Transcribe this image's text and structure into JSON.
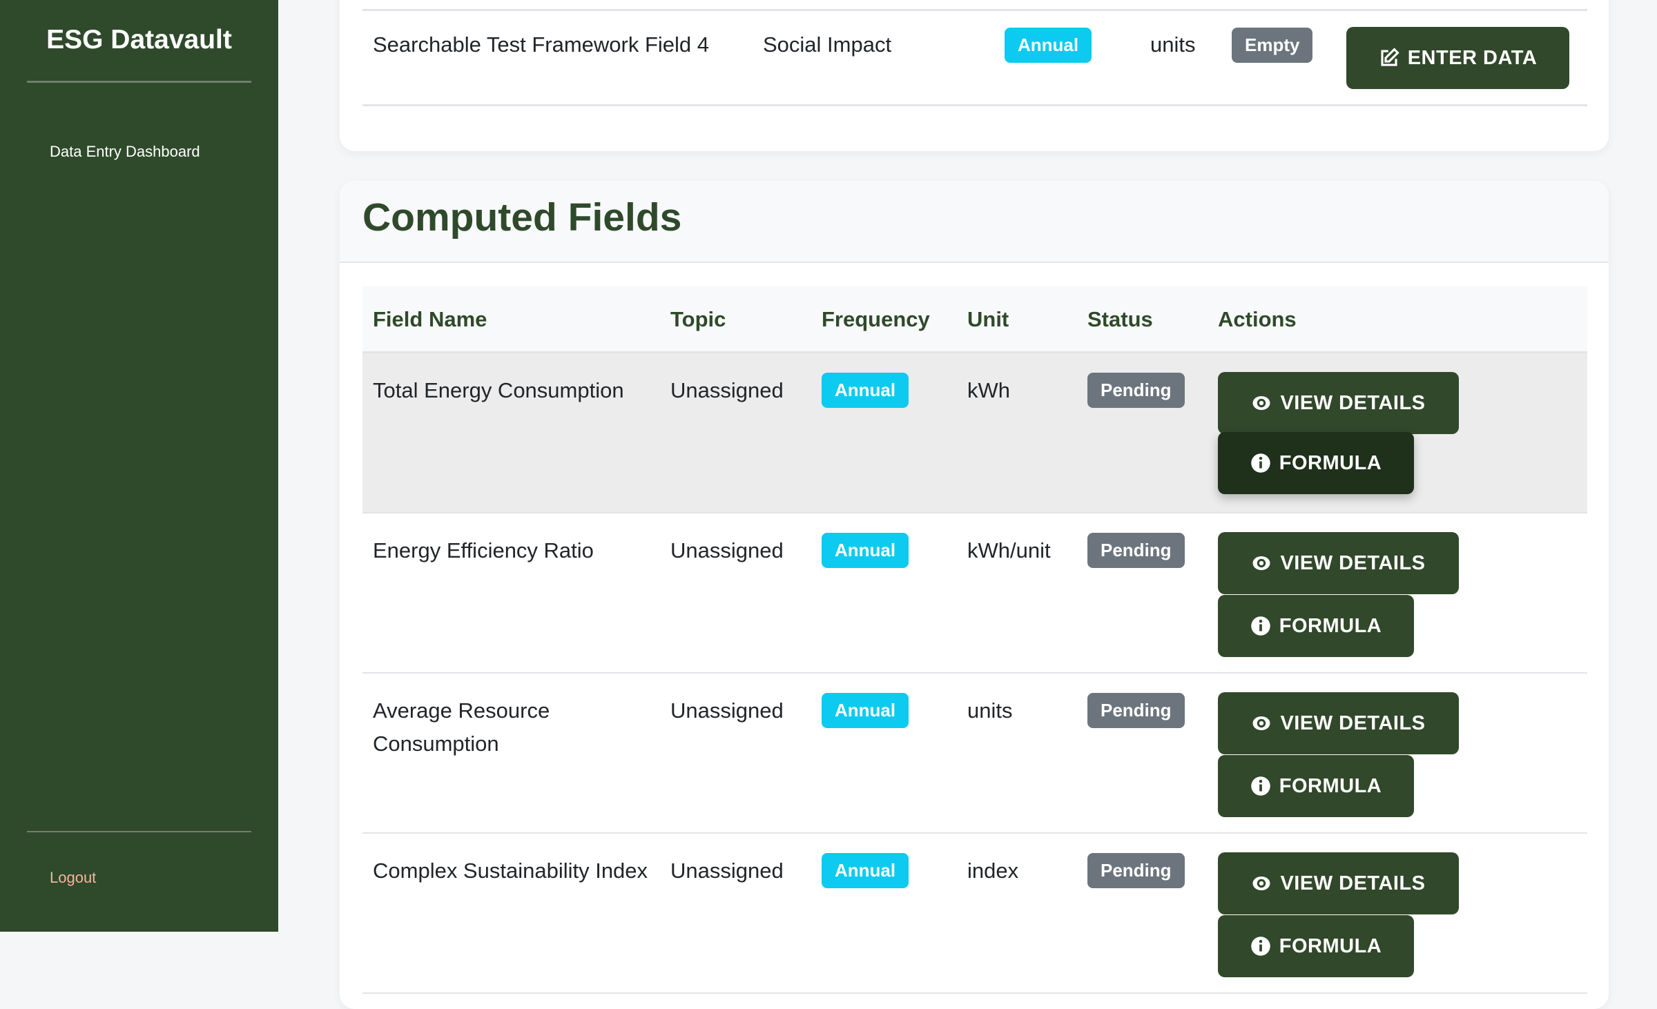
{
  "sidebar": {
    "brand": "ESG Datavault",
    "nav": [
      {
        "label": "Data Entry Dashboard"
      }
    ],
    "logout": "Logout"
  },
  "raw_row": {
    "field_name": "Searchable Test Framework Field 4",
    "topic": "Social Impact",
    "frequency": "Annual",
    "unit": "units",
    "status": "Empty",
    "action": "ENTER DATA"
  },
  "computed": {
    "title": "Computed Fields",
    "columns": [
      "Field Name",
      "Topic",
      "Frequency",
      "Unit",
      "Status",
      "Actions"
    ],
    "view_label": "VIEW DETAILS",
    "formula_label": "FORMULA",
    "rows": [
      {
        "field_name": "Total Energy Consumption",
        "topic": "Unassigned",
        "frequency": "Annual",
        "unit": "kWh",
        "status": "Pending"
      },
      {
        "field_name": "Energy Efficiency Ratio",
        "topic": "Unassigned",
        "frequency": "Annual",
        "unit": "kWh/unit",
        "status": "Pending"
      },
      {
        "field_name": "Average Resource Consumption",
        "topic": "Unassigned",
        "frequency": "Annual",
        "unit": "units",
        "status": "Pending"
      },
      {
        "field_name": "Complex Sustainability Index",
        "topic": "Unassigned",
        "frequency": "Annual",
        "unit": "index",
        "status": "Pending"
      }
    ]
  },
  "colors": {
    "brand_green": "#2f4a2b",
    "button": "#31482a",
    "info": "#0dcaf0",
    "secondary": "#6c757d"
  }
}
